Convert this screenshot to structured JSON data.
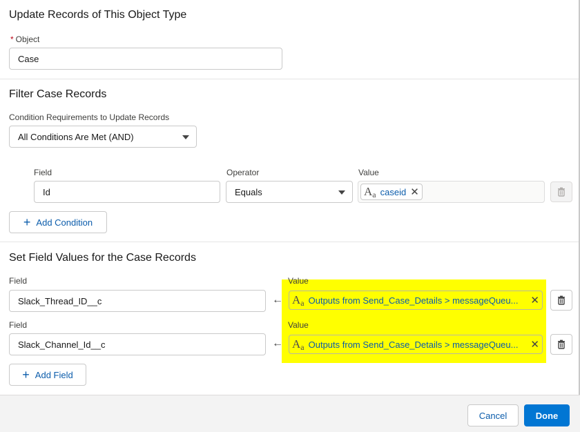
{
  "section_object": {
    "title": "Update Records of This Object Type",
    "required_mark": "*",
    "object_label": "Object",
    "object_value": "Case"
  },
  "section_filter": {
    "title": "Filter Case Records",
    "condition_label": "Condition Requirements to Update Records",
    "condition_value": "All Conditions Are Met (AND)",
    "col_field": "Field",
    "col_operator": "Operator",
    "col_value": "Value",
    "row": {
      "field": "Id",
      "operator": "Equals",
      "value_pill": "caseid",
      "icon_A": "A",
      "icon_a": "a"
    },
    "add_condition_label": "Add Condition"
  },
  "section_set": {
    "title": "Set Field Values for the Case Records",
    "rows": [
      {
        "field_label": "Field",
        "field_value": "Slack_Thread_ID__c",
        "value_label": "Value",
        "value_pill": "Outputs from Send_Case_Details > messageQueu..."
      },
      {
        "field_label": "Field",
        "field_value": "Slack_Channel_Id__c",
        "value_label": "Value",
        "value_pill": "Outputs from Send_Case_Details > messageQueu..."
      }
    ],
    "add_field_label": "Add Field",
    "icon_A": "A",
    "icon_a": "a"
  },
  "footer": {
    "cancel_label": "Cancel",
    "done_label": "Done"
  },
  "icons": {
    "close": "close-icon",
    "trash": "trash-icon",
    "add": "add-icon",
    "arrow": "arrow-left-icon",
    "caret": "chevron-down-icon"
  },
  "colors": {
    "link_blue": "#0b5cab",
    "brand_blue": "#0176d3",
    "highlight": "#ffff00",
    "required_red": "#ba0517"
  }
}
